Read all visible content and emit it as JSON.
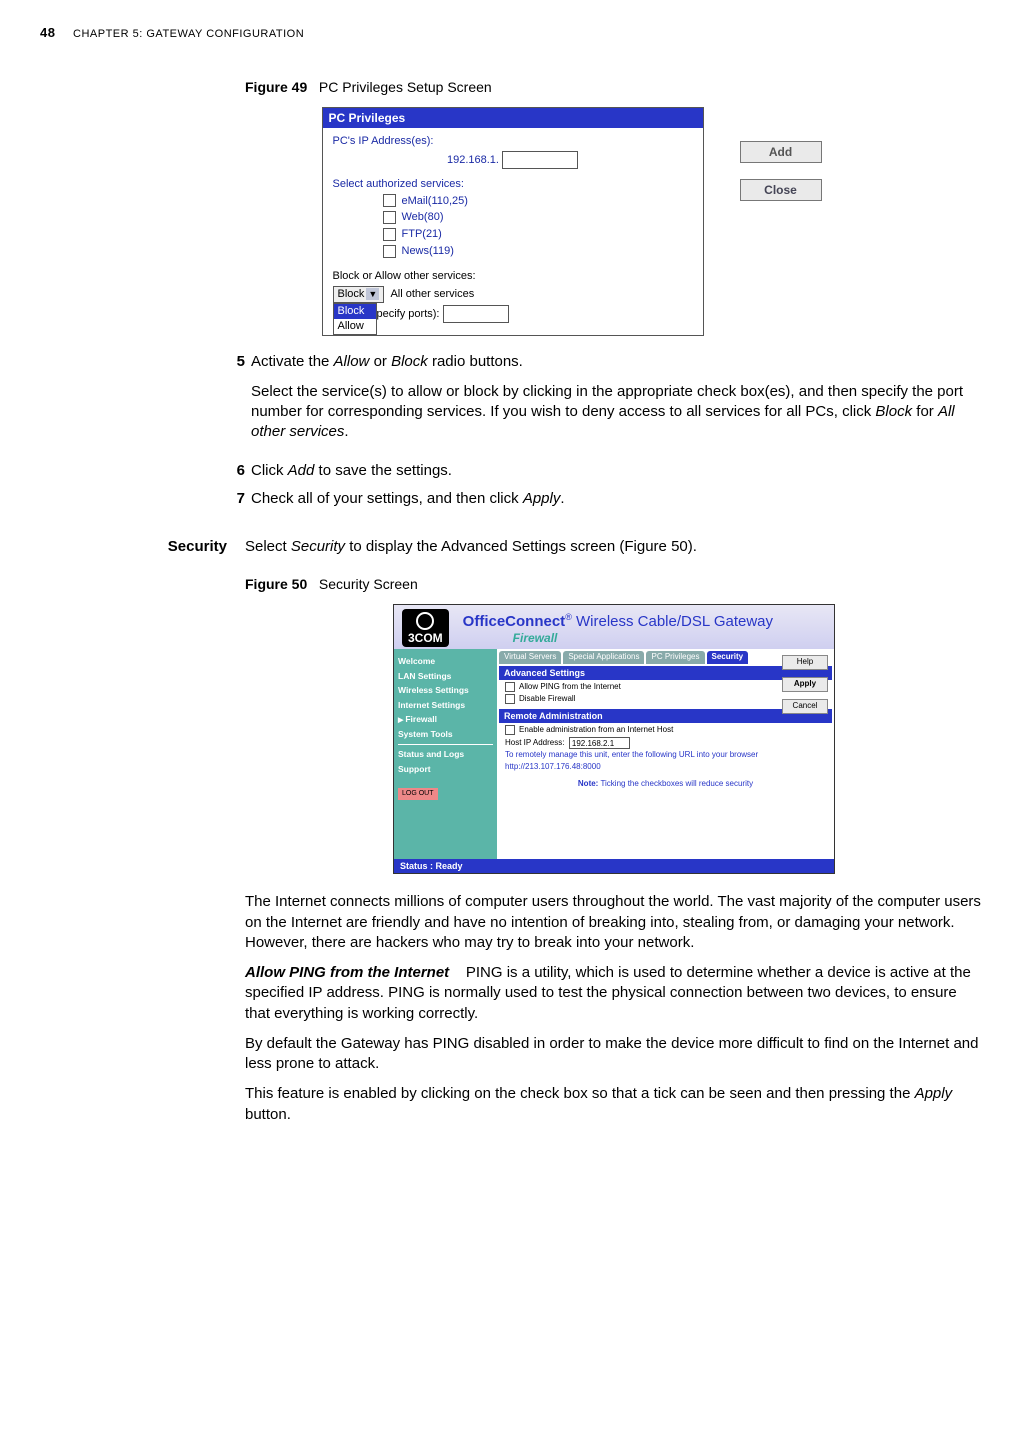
{
  "page": {
    "number": "48",
    "chapter": "CHAPTER 5: GATEWAY CONFIGURATION"
  },
  "fig49": {
    "label_bold": "Figure 49",
    "label_rest": "PC Privileges Setup Screen",
    "title": "PC Privileges",
    "ip_label": "PC's IP Address(es):",
    "ip_prefix": "192.168.1.",
    "services_label": "Select authorized services:",
    "svc_email": "eMail(110,25)",
    "svc_web": "Web(80)",
    "svc_ftp": "FTP(21)",
    "svc_news": "News(119)",
    "blockallow_label": "Block or Allow other services:",
    "select_value": "Block",
    "opt_block": "Block",
    "opt_allow": "Allow",
    "all_other": "All other services",
    "specify_ports_frag": "pecify ports):",
    "btn_add": "Add",
    "btn_close": "Close"
  },
  "steps": {
    "s5_label": "5",
    "s5_line1_a": "Activate the ",
    "s5_line1_allow": "Allow",
    "s5_line1_b": " or ",
    "s5_line1_block": "Block",
    "s5_line1_c": " radio buttons.",
    "s5_para_a": "Select the service(s) to allow or block by clicking in the appropriate check box(es), and then specify the port number for corresponding services. If you wish to deny access to all services for all PCs, click ",
    "s5_para_block": "Block",
    "s5_para_mid": " for ",
    "s5_para_allother": "All other services",
    "s5_para_end": ".",
    "s6_label": "6",
    "s6_a": "Click ",
    "s6_add": "Add",
    "s6_b": " to save the settings.",
    "s7_label": "7",
    "s7_a": "Check all of your settings, and then click ",
    "s7_apply": "Apply",
    "s7_b": "."
  },
  "security": {
    "heading": "Security",
    "intro_a": "Select ",
    "intro_sec": "Security",
    "intro_b": " to display the Advanced Settings screen (Figure 50)."
  },
  "fig50": {
    "label_bold": "Figure 50",
    "label_rest": "Security Screen",
    "logo": "3COM",
    "brand_bold": "OfficeConnect",
    "brand_reg": "®",
    "brand_rest": " Wireless Cable/DSL Gateway",
    "firewall_label": "Firewall",
    "nav_welcome": "Welcome",
    "nav_lan": "LAN Settings",
    "nav_wireless": "Wireless Settings",
    "nav_internet": "Internet Settings",
    "nav_firewall": "Firewall",
    "nav_system": "System Tools",
    "nav_status": "Status and Logs",
    "nav_support": "Support",
    "nav_logout": "LOG OUT",
    "tab_vs": "Virtual Servers",
    "tab_sa": "Special Applications",
    "tab_pc": "PC Privileges",
    "tab_sec": "Security",
    "panel_adv": "Advanced Settings",
    "adv_ping": "Allow PING from the Internet",
    "adv_disable": "Disable Firewall",
    "panel_remote": "Remote Administration",
    "rem_enable": "Enable administration from an Internet Host",
    "rem_host_label": "Host IP Address:",
    "rem_host_value": "192.168.2.1",
    "rem_hint": "To remotely manage this unit, enter the following URL into your browser",
    "rem_url": "http://213.107.176.48:8000",
    "note_bold": "Note:",
    "note_rest": " Ticking the checkboxes will reduce security",
    "btn_help": "Help",
    "btn_apply": "Apply",
    "btn_cancel": "Cancel",
    "status": "Status : Ready"
  },
  "body": {
    "p1": "The Internet connects millions of computer users throughout the world. The vast majority of the computer users on the Internet are friendly and have no intention of breaking into, stealing from, or damaging your network. However, there are hackers who may try to break into your network.",
    "h_ping": "Allow PING from the Internet",
    "ping_p1": "PING is a utility, which is used to determine whether a device is active at the specified IP address. PING is normally used to test the physical connection between two devices, to ensure that everything is working correctly.",
    "ping_p2": "By default the Gateway has PING disabled in order to make the device more difficult to find on the Internet and less prone to attack.",
    "ping_p3_a": "This feature is enabled by clicking on the check box so that a tick can be seen and then pressing the ",
    "ping_p3_apply": "Apply",
    "ping_p3_b": " button."
  }
}
